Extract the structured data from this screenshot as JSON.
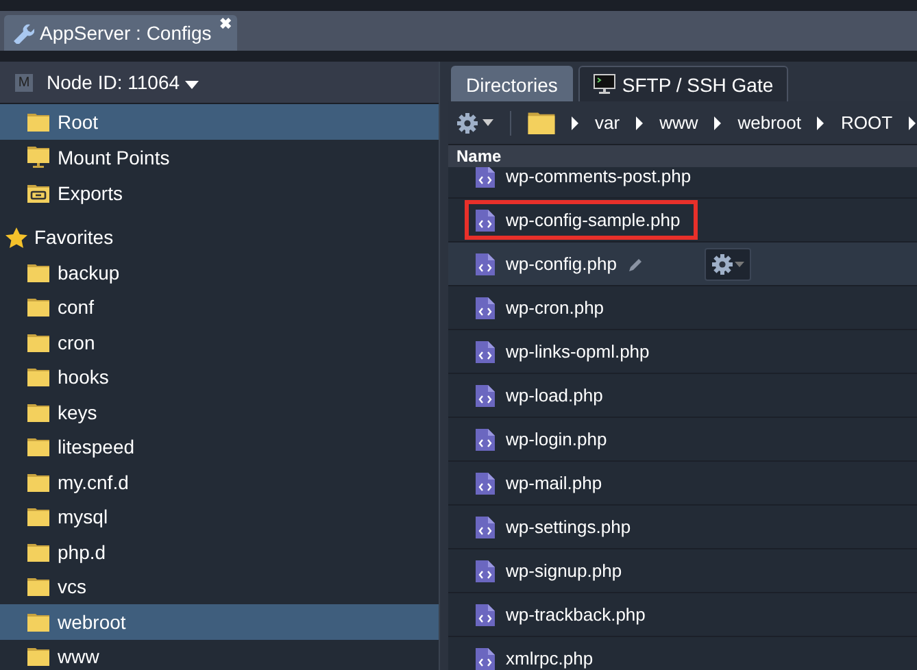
{
  "window_tab": {
    "title": "AppServer : Configs",
    "close": "✖"
  },
  "node_selector": {
    "badge": "M",
    "label": "Node ID: 11064"
  },
  "tree": {
    "items": [
      {
        "label": "Root",
        "kind": "folder",
        "selected": true
      },
      {
        "label": "Mount Points",
        "kind": "mount",
        "selected": false
      },
      {
        "label": "Exports",
        "kind": "export",
        "selected": false
      }
    ],
    "favorites": {
      "label": "Favorites",
      "items": [
        {
          "label": "backup",
          "selected": false
        },
        {
          "label": "conf",
          "selected": false
        },
        {
          "label": "cron",
          "selected": false
        },
        {
          "label": "hooks",
          "selected": false
        },
        {
          "label": "keys",
          "selected": false
        },
        {
          "label": "litespeed",
          "selected": false
        },
        {
          "label": "my.cnf.d",
          "selected": false
        },
        {
          "label": "mysql",
          "selected": false
        },
        {
          "label": "php.d",
          "selected": false
        },
        {
          "label": "vcs",
          "selected": false
        },
        {
          "label": "webroot",
          "selected": true
        },
        {
          "label": "www",
          "selected": false
        }
      ]
    }
  },
  "right_tabs": [
    {
      "label": "Directories",
      "selected": true
    },
    {
      "label": "SFTP / SSH Gate",
      "selected": false
    }
  ],
  "breadcrumb": [
    "var",
    "www",
    "webroot",
    "ROOT"
  ],
  "file_list": {
    "column": "Name",
    "files": [
      {
        "name": "wp-comments-post.php",
        "highlighted": false,
        "hovered": false
      },
      {
        "name": "wp-config-sample.php",
        "highlighted": true,
        "hovered": false
      },
      {
        "name": "wp-config.php",
        "highlighted": false,
        "hovered": true
      },
      {
        "name": "wp-cron.php",
        "highlighted": false,
        "hovered": false
      },
      {
        "name": "wp-links-opml.php",
        "highlighted": false,
        "hovered": false
      },
      {
        "name": "wp-load.php",
        "highlighted": false,
        "hovered": false
      },
      {
        "name": "wp-login.php",
        "highlighted": false,
        "hovered": false
      },
      {
        "name": "wp-mail.php",
        "highlighted": false,
        "hovered": false
      },
      {
        "name": "wp-settings.php",
        "highlighted": false,
        "hovered": false
      },
      {
        "name": "wp-signup.php",
        "highlighted": false,
        "hovered": false
      },
      {
        "name": "wp-trackback.php",
        "highlighted": false,
        "hovered": false
      },
      {
        "name": "xmlrpc.php",
        "highlighted": false,
        "hovered": false
      }
    ]
  }
}
